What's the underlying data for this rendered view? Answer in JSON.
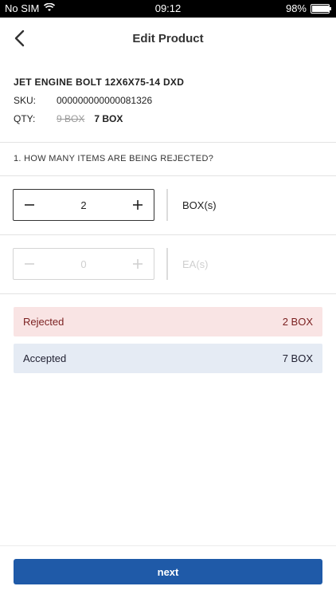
{
  "status_bar": {
    "carrier": "No SIM",
    "time": "09:12",
    "battery": "98%",
    "wifi_icon": "wifi-icon",
    "battery_icon": "battery-icon"
  },
  "header": {
    "title": "Edit Product",
    "back_icon": "chevron-left-icon"
  },
  "product": {
    "name": "JET ENGINE BOLT 12X6X75-14 DXD",
    "sku_label": "SKU:",
    "sku": "000000000000081326",
    "qty_label": "QTY:",
    "qty_old": "9 BOX",
    "qty_new": "7 BOX"
  },
  "question": "1. HOW MANY ITEMS ARE BEING REJECTED?",
  "steppers": [
    {
      "value": "2",
      "unit": "BOX(s)",
      "enabled": true,
      "minus_icon": "minus-icon",
      "plus_icon": "plus-icon"
    },
    {
      "value": "0",
      "unit": "EA(s)",
      "enabled": false,
      "minus_icon": "minus-icon",
      "plus_icon": "plus-icon"
    }
  ],
  "summary": {
    "rejected_label": "Rejected",
    "rejected_value": "2 BOX",
    "accepted_label": "Accepted",
    "accepted_value": "7 BOX"
  },
  "footer": {
    "next_label": "next"
  },
  "colors": {
    "primary": "#1f5aa8",
    "rejected_bg": "#f9e4e4",
    "accepted_bg": "#e5ebf4"
  }
}
